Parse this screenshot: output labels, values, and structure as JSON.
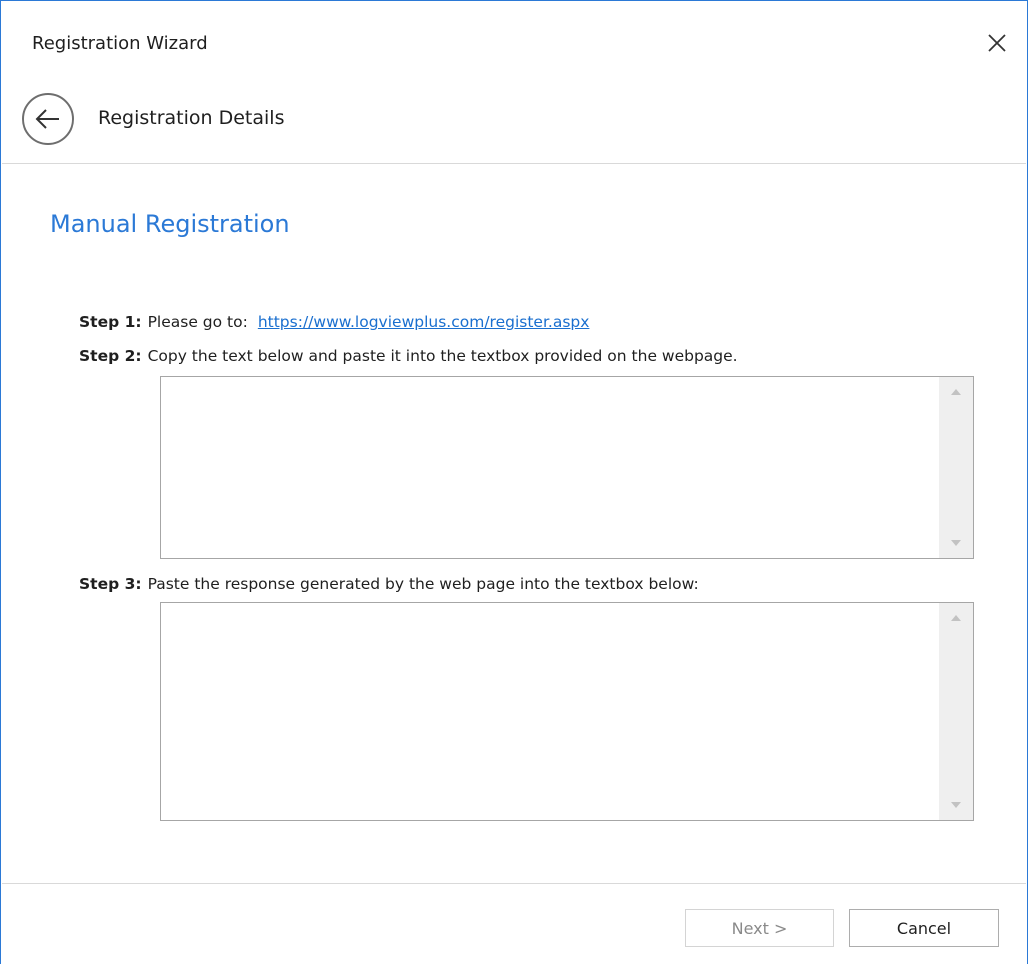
{
  "window": {
    "title": "Registration Wizard",
    "close_icon": "close-icon"
  },
  "header": {
    "back_icon": "back-arrow-icon",
    "page_title": "Registration Details"
  },
  "main": {
    "heading": "Manual Registration",
    "step1": {
      "label": "Step 1:",
      "text": "Please go to:",
      "link": "https://www.logviewplus.com/register.aspx"
    },
    "step2": {
      "label": "Step 2:",
      "text": "Copy the text below and paste it into the textbox provided on the webpage.",
      "textbox_value": ""
    },
    "step3": {
      "label": "Step 3:",
      "text": "Paste the response generated by the web page into the textbox below:",
      "textbox_value": ""
    }
  },
  "footer": {
    "next_label": "Next >",
    "cancel_label": "Cancel"
  },
  "colors": {
    "accent": "#2b79d6",
    "link": "#1a6fcf"
  }
}
